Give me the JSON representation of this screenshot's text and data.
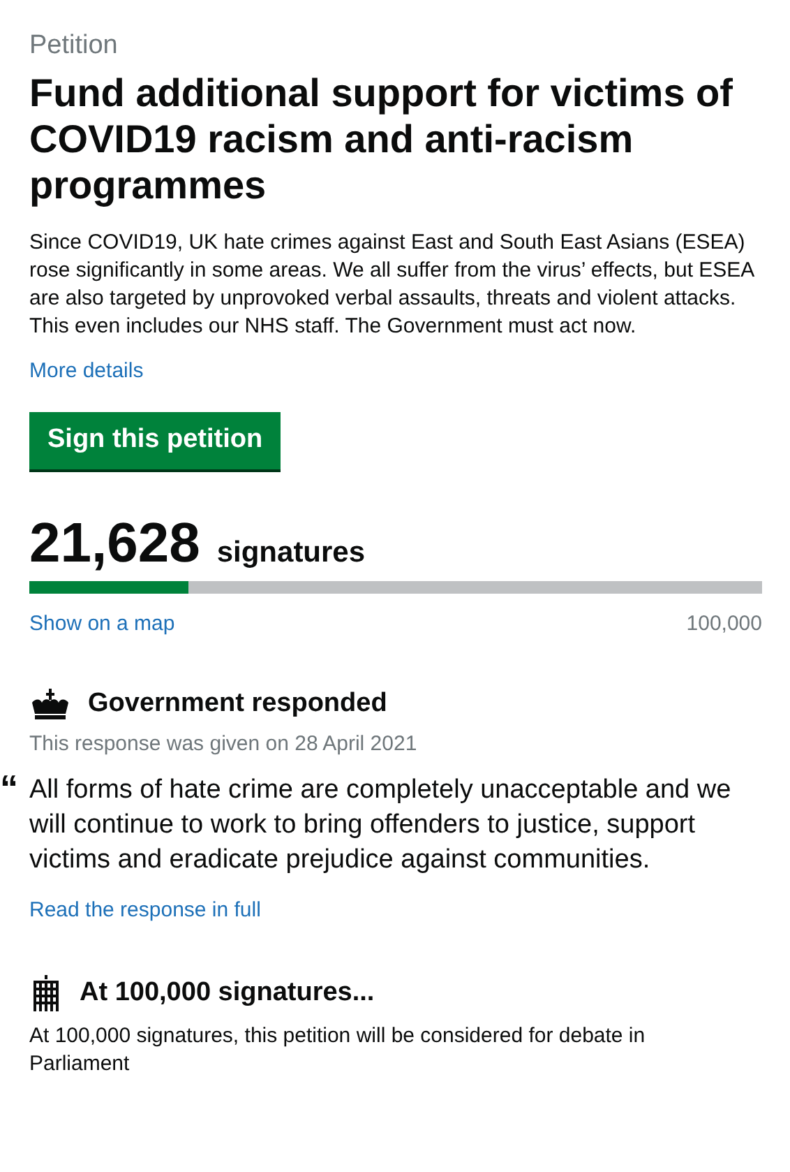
{
  "caption": "Petition",
  "title": "Fund additional support for victims of COVID19 racism and anti-racism programmes",
  "summary": "Since COVID19, UK hate crimes against East and South East Asians (ESEA) rose significantly in some areas. We all suffer from the virus’ effects, but ESEA are also targeted by unprovoked verbal assaults, threats and violent attacks. This even includes our NHS staff. The Government must act now.",
  "more_details": "More details",
  "sign_button": "Sign this petition",
  "signatures": {
    "count": "21,628",
    "label": "signatures",
    "level": 0.21628,
    "map_link": "Show on a map",
    "target": "100,000"
  },
  "response": {
    "heading": "Government responded",
    "date": "This response was given on 28 April 2021",
    "quote_mark": "“",
    "quote": "All forms of hate crime are completely unacceptable and we will continue to work to bring offenders to justice, support victims and eradicate prejudice against communities.",
    "link": "Read the response in full"
  },
  "debate": {
    "heading": "At 100,000 signatures...",
    "text": "At 100,000 signatures, this petition will be considered for debate in Parliament"
  }
}
